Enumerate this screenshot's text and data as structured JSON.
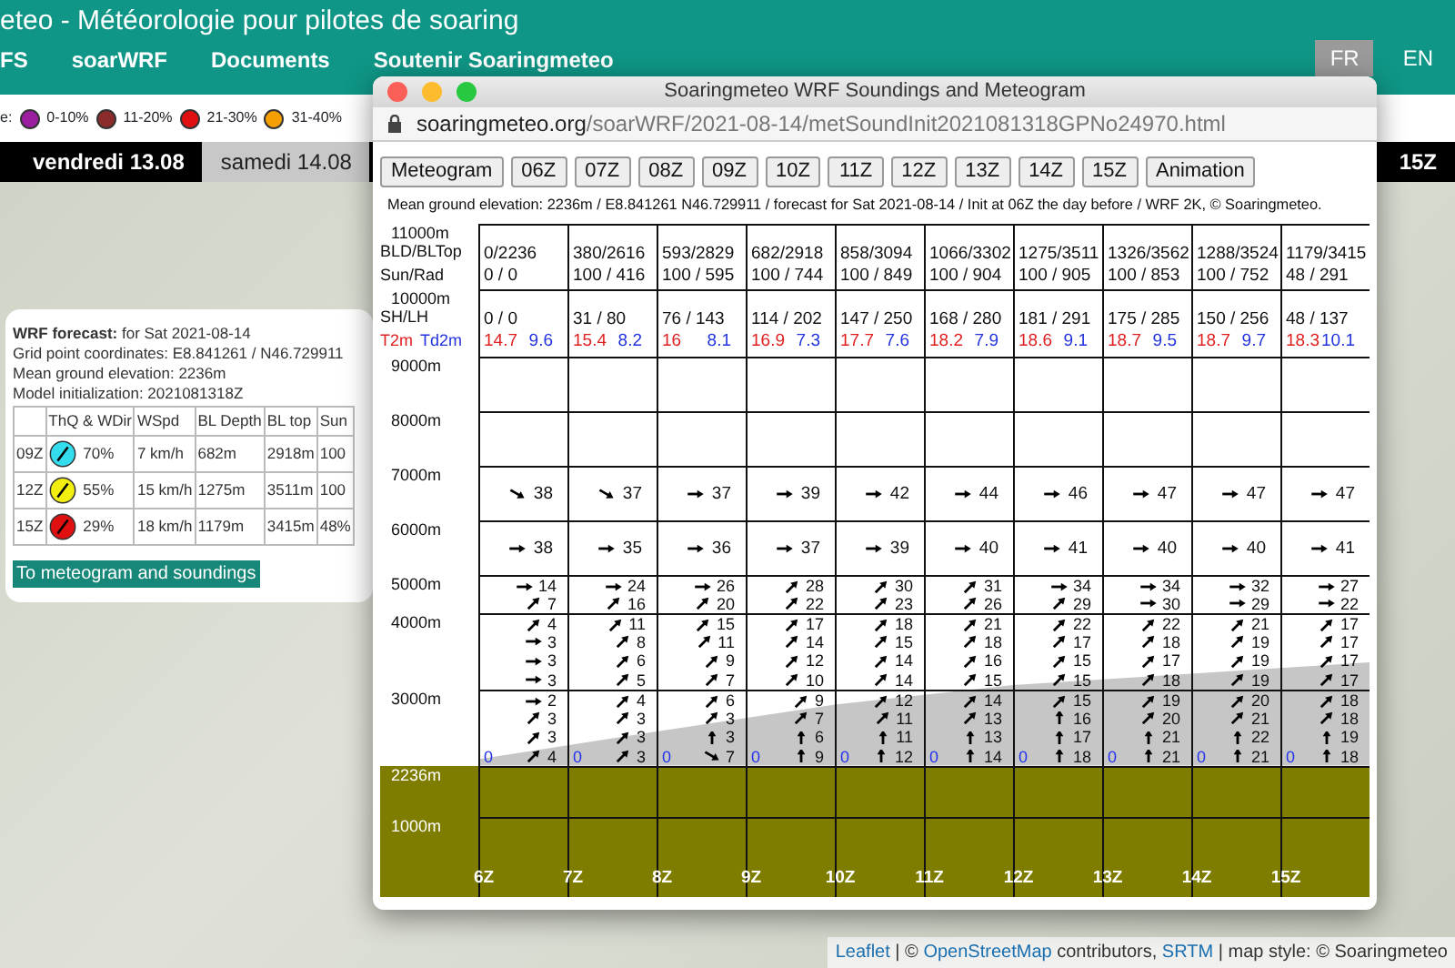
{
  "header": {
    "title": "eteo - Météorologie pour pilotes de soaring"
  },
  "nav": [
    {
      "label": "FS"
    },
    {
      "label": "soarWRF"
    },
    {
      "label": "Documents"
    },
    {
      "label": "Soutenir Soaringmeteo"
    }
  ],
  "languages": [
    {
      "label": "FR",
      "selected": true
    },
    {
      "label": "EN",
      "selected": false
    }
  ],
  "legend": {
    "label": "e:",
    "items": [
      {
        "label": "0-10%",
        "color": "#9c1ea0"
      },
      {
        "label": "11-20%",
        "color": "#8b2b2b"
      },
      {
        "label": "21-30%",
        "color": "#e01010"
      },
      {
        "label": "31-40%",
        "color": "#f5a000"
      }
    ]
  },
  "date_tabs": [
    {
      "label": "vendredi 13.08",
      "selected": false
    },
    {
      "label": "samedi 14.08",
      "selected": true
    }
  ],
  "time_label": "15Z",
  "forecast_popup": {
    "heading": "**WRF forecast:** for Sat 2021-08-14",
    "lines": [
      "Grid point coordinates: E8.841261 / N46.729911",
      "Mean ground elevation: 2236m",
      "Model initialization: 2021081318Z"
    ],
    "columns": [
      "ThQ & WDir",
      "WSpd",
      "BL Depth",
      "BL top",
      "Sun"
    ],
    "rows": [
      {
        "time": "09Z",
        "thq": "70%",
        "color": "#33ddee",
        "wspd": "7 km/h",
        "bl_depth": "682m",
        "bl_top": "2918m",
        "sun": "100"
      },
      {
        "time": "12Z",
        "thq": "55%",
        "color": "#f2ee10",
        "wspd": "15 km/h",
        "bl_depth": "1275m",
        "bl_top": "3511m",
        "sun": "100"
      },
      {
        "time": "15Z",
        "thq": "29%",
        "color": "#e01010",
        "wspd": "18 km/h",
        "bl_depth": "1179m",
        "bl_top": "3415m",
        "sun": "48%"
      }
    ],
    "button": "To meteogram and soundings"
  },
  "window": {
    "title": "Soaringmeteo WRF Soundings and Meteogram",
    "url": {
      "host": "soaringmeteo.org",
      "path": "/soarWRF/2021-08-14/metSoundInit2021081318GPNo24970.html"
    },
    "buttons": [
      "Meteogram",
      "06Z",
      "07Z",
      "08Z",
      "09Z",
      "10Z",
      "11Z",
      "12Z",
      "13Z",
      "14Z",
      "15Z",
      "Animation"
    ],
    "info": "Mean ground elevation: 2236m / E8.841261 N46.729911 / forecast for Sat 2021-08-14 / Init at 06Z the day before / WRF 2K, © Soaringmeteo.",
    "meteogram": {
      "columns": [
        "6Z",
        "7Z",
        "8Z",
        "9Z",
        "10Z",
        "11Z",
        "12Z",
        "13Z",
        "14Z",
        "15Z"
      ],
      "rows": [
        {
          "kind": "text",
          "axis": "11000m",
          "label": "BLD/BLTop",
          "values": [
            "0/2236",
            "380/2616",
            "593/2829",
            "682/2918",
            "858/3094",
            "1066/3302",
            "1275/3511",
            "1326/3562",
            "1288/3524",
            "1179/3415"
          ]
        },
        {
          "kind": "text",
          "label": "Sun/Rad",
          "values": [
            "0 / 0",
            "100 / 416",
            "100 / 595",
            "100 / 744",
            "100 / 849",
            "100 / 904",
            "100 / 905",
            "100 / 853",
            "100 / 752",
            "48 / 291"
          ]
        },
        {
          "kind": "text",
          "axis": "10000m",
          "label": "SH/LH",
          "values": [
            "0 / 0",
            "31 / 80",
            "76 / 143",
            "114 / 202",
            "147 / 250",
            "168 / 280",
            "181 / 291",
            "175 / 285",
            "150 / 256",
            "48 / 137"
          ]
        },
        {
          "kind": "temps",
          "label_t": "T2m",
          "label_td": "Td2m",
          "t": [
            "14.7",
            "15.4",
            "16",
            "16.9",
            "17.7",
            "18.2",
            "18.6",
            "18.7",
            "18.7",
            "18.3"
          ],
          "td": [
            "9.6",
            "8.2",
            "8.1",
            "7.3",
            "7.6",
            "7.9",
            "9.1",
            "9.5",
            "9.7",
            "10.1"
          ]
        },
        {
          "kind": "empty",
          "axis": "9000m"
        },
        {
          "kind": "empty",
          "axis": "8000m"
        },
        {
          "kind": "wind_upper",
          "axis": "7000m",
          "cells": [
            {
              "speed": "38",
              "kind": "southeast"
            },
            {
              "speed": "37",
              "kind": "southeast"
            },
            {
              "speed": "37",
              "kind": "east"
            },
            {
              "speed": "39",
              "kind": "east"
            },
            {
              "speed": "42",
              "kind": "east"
            },
            {
              "speed": "44",
              "kind": "east"
            },
            {
              "speed": "46",
              "kind": "east"
            },
            {
              "speed": "47",
              "kind": "east"
            },
            {
              "speed": "47",
              "kind": "east"
            },
            {
              "speed": "47",
              "kind": "east"
            }
          ]
        },
        {
          "kind": "wind_upper",
          "axis": "6000m",
          "cells": [
            {
              "speed": "38",
              "kind": "east"
            },
            {
              "speed": "35",
              "kind": "east"
            },
            {
              "speed": "36",
              "kind": "east"
            },
            {
              "speed": "37",
              "kind": "east"
            },
            {
              "speed": "39",
              "kind": "east"
            },
            {
              "speed": "40",
              "kind": "east"
            },
            {
              "speed": "41",
              "kind": "east"
            },
            {
              "speed": "40",
              "kind": "east"
            },
            {
              "speed": "40",
              "kind": "east"
            },
            {
              "speed": "41",
              "kind": "east"
            }
          ]
        },
        {
          "kind": "wind",
          "axis": "5000m",
          "cells": [
            {
              "speed": "14",
              "kind": "east"
            },
            {
              "speed": "24",
              "kind": "east"
            },
            {
              "speed": "26",
              "kind": "east"
            },
            {
              "speed": "28",
              "kind": "northeast"
            },
            {
              "speed": "30",
              "kind": "northeast"
            },
            {
              "speed": "31",
              "kind": "northeast"
            },
            {
              "speed": "34",
              "kind": "east"
            },
            {
              "speed": "34",
              "kind": "east"
            },
            {
              "speed": "32",
              "kind": "east"
            },
            {
              "speed": "27",
              "kind": "east"
            }
          ]
        },
        {
          "kind": "wind",
          "cells": [
            {
              "speed": "7",
              "kind": "northeast"
            },
            {
              "speed": "16",
              "kind": "northeast"
            },
            {
              "speed": "20",
              "kind": "northeast"
            },
            {
              "speed": "22",
              "kind": "northeast"
            },
            {
              "speed": "23",
              "kind": "northeast"
            },
            {
              "speed": "26",
              "kind": "northeast"
            },
            {
              "speed": "29",
              "kind": "northeast"
            },
            {
              "speed": "30",
              "kind": "east"
            },
            {
              "speed": "29",
              "kind": "east"
            },
            {
              "speed": "22",
              "kind": "east"
            }
          ]
        },
        {
          "kind": "wind",
          "axis": "4000m",
          "cells": [
            {
              "speed": "4",
              "kind": "northeast"
            },
            {
              "speed": "11",
              "kind": "northeast"
            },
            {
              "speed": "15",
              "kind": "northeast"
            },
            {
              "speed": "17",
              "kind": "northeast"
            },
            {
              "speed": "18",
              "kind": "northeast"
            },
            {
              "speed": "21",
              "kind": "northeast"
            },
            {
              "speed": "22",
              "kind": "northeast"
            },
            {
              "speed": "22",
              "kind": "northeast"
            },
            {
              "speed": "21",
              "kind": "northeast"
            },
            {
              "speed": "17",
              "kind": "northeast"
            }
          ]
        },
        {
          "kind": "wind",
          "cells": [
            {
              "speed": "3",
              "kind": "east"
            },
            {
              "speed": "8",
              "kind": "northeast"
            },
            {
              "speed": "11",
              "kind": "northeast"
            },
            {
              "speed": "14",
              "kind": "northeast"
            },
            {
              "speed": "15",
              "kind": "northeast"
            },
            {
              "speed": "18",
              "kind": "northeast"
            },
            {
              "speed": "17",
              "kind": "northeast"
            },
            {
              "speed": "18",
              "kind": "northeast"
            },
            {
              "speed": "19",
              "kind": "northeast"
            },
            {
              "speed": "17",
              "kind": "northeast"
            }
          ]
        },
        {
          "kind": "wind",
          "cells": [
            {
              "speed": "3",
              "kind": "east"
            },
            {
              "speed": "6",
              "kind": "northeast"
            },
            {
              "speed": "9",
              "kind": "northeast"
            },
            {
              "speed": "12",
              "kind": "northeast"
            },
            {
              "speed": "14",
              "kind": "northeast"
            },
            {
              "speed": "16",
              "kind": "northeast"
            },
            {
              "speed": "15",
              "kind": "northeast"
            },
            {
              "speed": "17",
              "kind": "northeast"
            },
            {
              "speed": "19",
              "kind": "northeast"
            },
            {
              "speed": "17",
              "kind": "northeast"
            }
          ]
        },
        {
          "kind": "wind",
          "cells": [
            {
              "speed": "3",
              "kind": "east"
            },
            {
              "speed": "5",
              "kind": "northeast"
            },
            {
              "speed": "7",
              "kind": "northeast"
            },
            {
              "speed": "10",
              "kind": "northeast"
            },
            {
              "speed": "14",
              "kind": "northeast"
            },
            {
              "speed": "15",
              "kind": "northeast"
            },
            {
              "speed": "15",
              "kind": "northeast"
            },
            {
              "speed": "18",
              "kind": "northeast"
            },
            {
              "speed": "19",
              "kind": "northeast"
            },
            {
              "speed": "17",
              "kind": "northeast"
            }
          ]
        },
        {
          "kind": "wind",
          "axis": "3000m",
          "cells": [
            {
              "speed": "2",
              "kind": "east"
            },
            {
              "speed": "4",
              "kind": "northeast"
            },
            {
              "speed": "6",
              "kind": "northeast"
            },
            {
              "speed": "9",
              "kind": "northeast"
            },
            {
              "speed": "12",
              "kind": "northeast"
            },
            {
              "speed": "14",
              "kind": "northeast"
            },
            {
              "speed": "15",
              "kind": "northeast"
            },
            {
              "speed": "19",
              "kind": "northeast"
            },
            {
              "speed": "20",
              "kind": "northeast"
            },
            {
              "speed": "18",
              "kind": "northeast"
            }
          ]
        },
        {
          "kind": "wind",
          "cells": [
            {
              "speed": "3",
              "kind": "northeast"
            },
            {
              "speed": "3",
              "kind": "northeast"
            },
            {
              "speed": "3",
              "kind": "northeast"
            },
            {
              "speed": "7",
              "kind": "northeast"
            },
            {
              "speed": "11",
              "kind": "northeast"
            },
            {
              "speed": "13",
              "kind": "northeast"
            },
            {
              "speed": "16",
              "kind": "north"
            },
            {
              "speed": "20",
              "kind": "northeast"
            },
            {
              "speed": "21",
              "kind": "northeast"
            },
            {
              "speed": "18",
              "kind": "northeast"
            }
          ]
        },
        {
          "kind": "wind",
          "cells": [
            {
              "speed": "3",
              "kind": "northeast"
            },
            {
              "speed": "3",
              "kind": "northeast"
            },
            {
              "speed": "3",
              "kind": "north"
            },
            {
              "speed": "6",
              "kind": "north"
            },
            {
              "speed": "11",
              "kind": "north"
            },
            {
              "speed": "13",
              "kind": "north"
            },
            {
              "speed": "17",
              "kind": "north"
            },
            {
              "speed": "21",
              "kind": "north"
            },
            {
              "speed": "22",
              "kind": "north"
            },
            {
              "speed": "19",
              "kind": "north"
            }
          ]
        },
        {
          "kind": "wind",
          "cells": [
            {
              "speed": "4",
              "kind": "northeast"
            },
            {
              "speed": "3",
              "kind": "northeast"
            },
            {
              "speed": "7",
              "kind": "southeast"
            },
            {
              "speed": "9",
              "kind": "north"
            },
            {
              "speed": "12",
              "kind": "north"
            },
            {
              "speed": "14",
              "kind": "north"
            },
            {
              "speed": "18",
              "kind": "north"
            },
            {
              "speed": "21",
              "kind": "north"
            },
            {
              "speed": "21",
              "kind": "north"
            },
            {
              "speed": "18",
              "kind": "north"
            }
          ],
          "marks": [
            "0",
            "0",
            "0",
            "0",
            "0",
            "0",
            "0",
            "0",
            "0",
            "0"
          ]
        },
        {
          "kind": "ground",
          "axis": "2236m"
        },
        {
          "kind": "ground",
          "axis": "1000m"
        }
      ]
    }
  },
  "attribution": [
    {
      "text": "Leaflet",
      "link": true
    },
    {
      "text": " | © ",
      "link": false
    },
    {
      "text": "OpenStreetMap",
      "link": true
    },
    {
      "text": " contributors, ",
      "link": false
    },
    {
      "text": "SRTM",
      "link": true
    },
    {
      "text": " | map style: © Soaringmeteo",
      "link": false
    }
  ]
}
